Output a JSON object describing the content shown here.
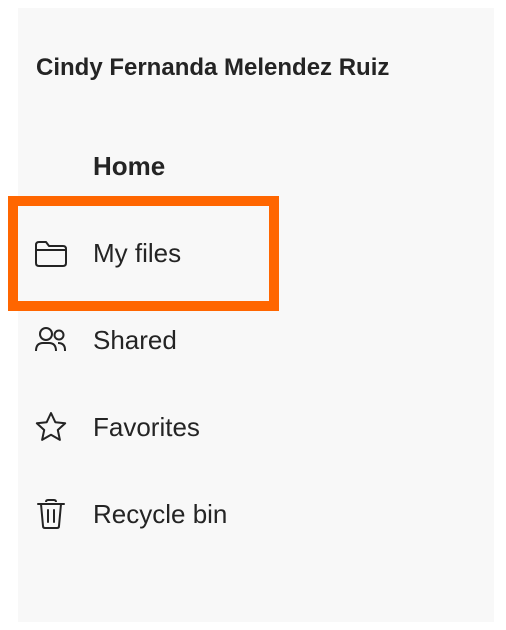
{
  "user": {
    "name": "Cindy Fernanda Melendez Ruiz"
  },
  "nav": {
    "items": [
      {
        "label": "Home",
        "icon": "",
        "bold": true
      },
      {
        "label": "My files",
        "icon": "folder-icon",
        "highlighted": true
      },
      {
        "label": "Shared",
        "icon": "people-icon"
      },
      {
        "label": "Favorites",
        "icon": "star-icon"
      },
      {
        "label": "Recycle bin",
        "icon": "trash-icon"
      }
    ]
  },
  "colors": {
    "highlight": "#ff6600",
    "panel_bg": "#f8f8f8",
    "text": "#242424"
  }
}
